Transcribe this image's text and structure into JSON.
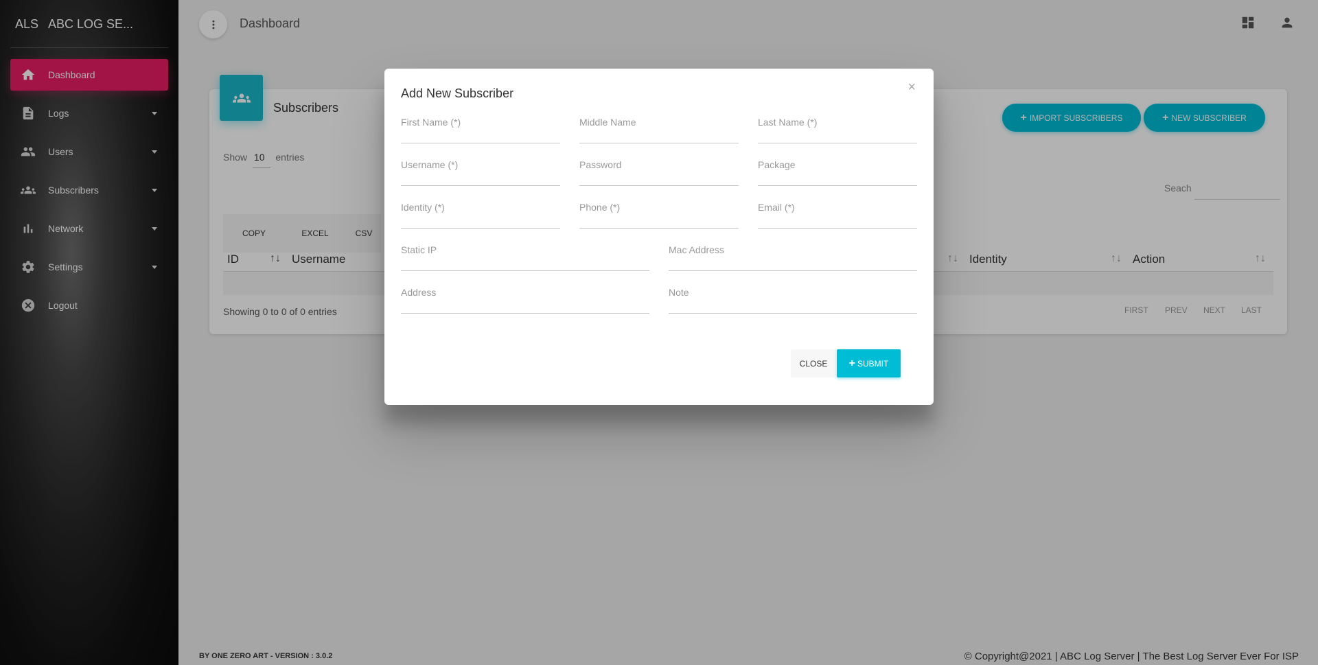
{
  "brand": {
    "mini": "ALS",
    "name": "ABC LOG SE..."
  },
  "sidebar": {
    "items": [
      {
        "label": "Dashboard",
        "icon": "home-icon",
        "active": true
      },
      {
        "label": "Logs",
        "icon": "document-icon",
        "dropdown": true
      },
      {
        "label": "Users",
        "icon": "users-icon",
        "dropdown": true
      },
      {
        "label": "Subscribers",
        "icon": "groups-icon",
        "dropdown": true
      },
      {
        "label": "Network",
        "icon": "bar-chart-icon",
        "dropdown": true
      },
      {
        "label": "Settings",
        "icon": "gear-icon",
        "dropdown": true
      },
      {
        "label": "Logout",
        "icon": "cancel-circle-icon"
      }
    ]
  },
  "topbar": {
    "title": "Dashboard"
  },
  "card": {
    "title": "Subscribers",
    "import_label": "IMPORT SUBSCRIBERS",
    "new_label": "NEW SUBSCRIBER",
    "show_label": "Show",
    "show_value": "10",
    "entries_label": "entries",
    "search_label": "Seach",
    "export_buttons": [
      "COPY",
      "EXCEL",
      "CSV"
    ],
    "columns": [
      "ID",
      "Username",
      "Identity",
      "Action"
    ],
    "info": "Showing 0 to 0 of 0 entries",
    "pager": [
      "FIRST",
      "PREV",
      "NEXT",
      "LAST"
    ]
  },
  "footer": {
    "left": "BY ONE ZERO ART - VERSION : 3.0.2",
    "right": "© Copyright@2021 | ABC Log Server | The Best Log Server Ever For ISP"
  },
  "modal": {
    "title": "Add New Subscriber",
    "close_icon": "×",
    "fields": {
      "first_name": "First Name (*)",
      "middle_name": "Middle Name",
      "last_name": "Last Name (*)",
      "username": "Username (*)",
      "password": "Password",
      "package": "Package",
      "identity": "Identity (*)",
      "phone": "Phone (*)",
      "email": "Email (*)",
      "static_ip": "Static IP",
      "mac_address": "Mac Address",
      "address": "Address",
      "note": "Note"
    },
    "close_label": "CLOSE",
    "submit_label": "SUBMIT"
  },
  "colors": {
    "primary": "#00bcd4",
    "active_nav": "#e91e63"
  }
}
